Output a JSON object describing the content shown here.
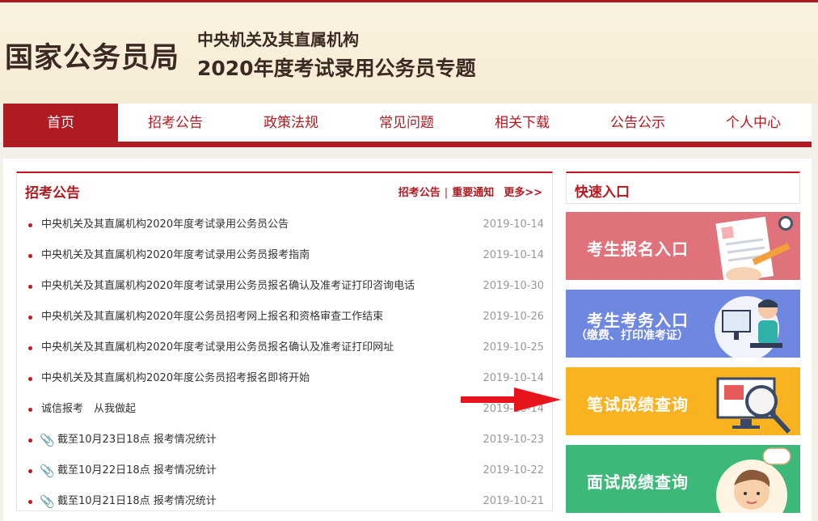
{
  "header": {
    "site_name": "国家公务员局",
    "subtitle_1": "中央机关及其直属机构",
    "subtitle_2": "2020年度考试录用公务员专题"
  },
  "nav": {
    "items": [
      "首页",
      "招考公告",
      "政策法规",
      "常见问题",
      "相关下载",
      "公告公示",
      "个人中心"
    ],
    "active_index": 0
  },
  "announcements": {
    "title": "招考公告",
    "links": [
      "招考公告",
      "重要通知"
    ],
    "separator": "|",
    "more": "更多>>",
    "items": [
      {
        "title": "中央机关及其直属机构2020年度考试录用公务员公告",
        "date": "2019-10-14",
        "attachment": false
      },
      {
        "title": "中央机关及其直属机构2020年度考试录用公务员报考指南",
        "date": "2019-10-14",
        "attachment": false
      },
      {
        "title": "中央机关及其直属机构2020年度考试录用公务员报名确认及准考证打印咨询电话",
        "date": "2019-10-30",
        "attachment": false
      },
      {
        "title": "中央机关及其直属机构2020年度公务员招考网上报名和资格审查工作结束",
        "date": "2019-10-26",
        "attachment": false
      },
      {
        "title": "中央机关及其直属机构2020年度考试录用公务员报名确认及准考证打印网址",
        "date": "2019-10-25",
        "attachment": false
      },
      {
        "title": "中央机关及其直属机构2020年度公务员招考报名即将开始",
        "date": "2019-10-14",
        "attachment": false
      },
      {
        "title": "诚信报考　从我做起",
        "date": "2019-10-14",
        "attachment": false
      },
      {
        "title": "截至10月23日18点 报考情况统计",
        "date": "2019-10-23",
        "attachment": true
      },
      {
        "title": "截至10月22日18点 报考情况统计",
        "date": "2019-10-22",
        "attachment": true
      },
      {
        "title": "截至10月21日18点 报考情况统计",
        "date": "2019-10-21",
        "attachment": true
      }
    ]
  },
  "quick_entry": {
    "title": "快速入口",
    "cards": [
      {
        "label": "考生报名入口",
        "sublabel": "",
        "color": "#e0727b",
        "icon": "form-writing-icon"
      },
      {
        "label": "考生考务入口",
        "sublabel": "（缴费、打印准考证）",
        "color": "#6e87e0",
        "icon": "computer-user-icon"
      },
      {
        "label": "笔试成绩查询",
        "sublabel": "",
        "color": "#f9b321",
        "icon": "magnifier-monitor-icon"
      },
      {
        "label": "面试成绩查询",
        "sublabel": "",
        "color": "#3cb878",
        "icon": "interview-person-icon"
      }
    ]
  },
  "colors": {
    "brand_red": "#b01b22",
    "arrow_red": "#e8141c"
  }
}
